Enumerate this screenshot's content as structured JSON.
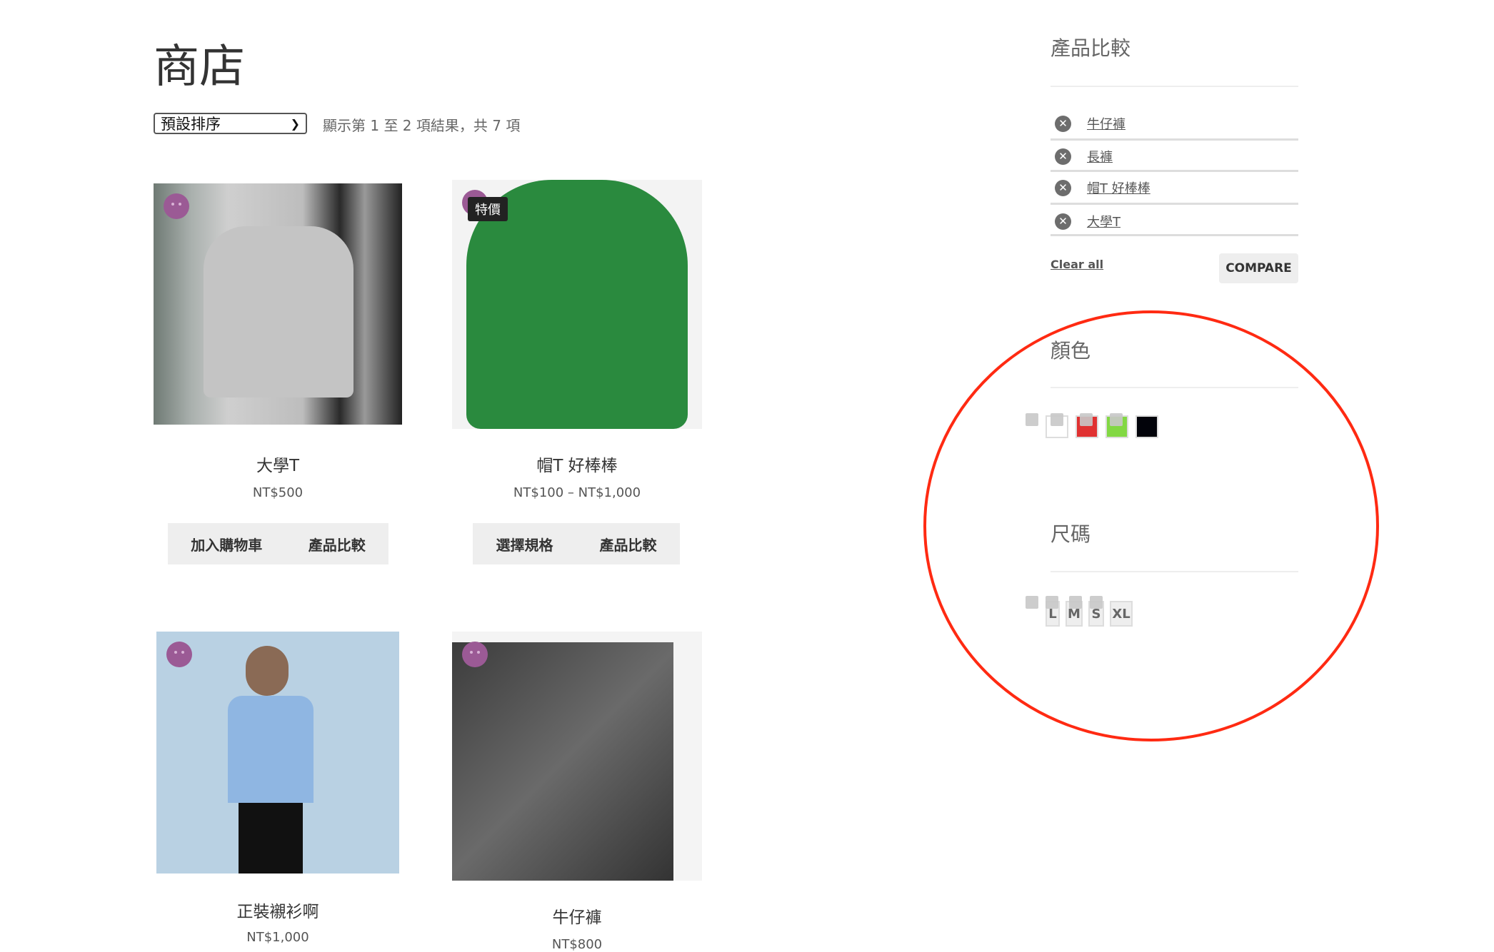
{
  "page": {
    "title": "商店",
    "sort_selected": "預設排序",
    "result_count": "顯示第 1 至 2 項結果，共 7 項"
  },
  "products": [
    {
      "name": "大學T",
      "price": "NT$500",
      "buttons": [
        "加入購物車",
        "產品比較"
      ]
    },
    {
      "name": "帽T 好棒棒",
      "price": "NT$100 – NT$1,000",
      "badge": "特價",
      "buttons": [
        "選擇規格",
        "產品比較"
      ]
    },
    {
      "name": "正裝襯衫啊",
      "price": "NT$1,000"
    },
    {
      "name": "牛仔褲",
      "price": "NT$800"
    }
  ],
  "sidebar": {
    "compare_title": "產品比較",
    "compare_items": [
      "牛仔褲",
      "長褲",
      "帽T 好棒棒",
      "大學T"
    ],
    "clear_all": "Clear all",
    "compare_button": "COMPARE",
    "color_title": "顏色",
    "colors": [
      "#ffffff",
      "#e03131",
      "#82d843",
      "#02030a"
    ],
    "size_title": "尺碼",
    "sizes": [
      "L",
      "M",
      "S",
      "XL"
    ]
  },
  "annotation_color": "#ff2a12"
}
